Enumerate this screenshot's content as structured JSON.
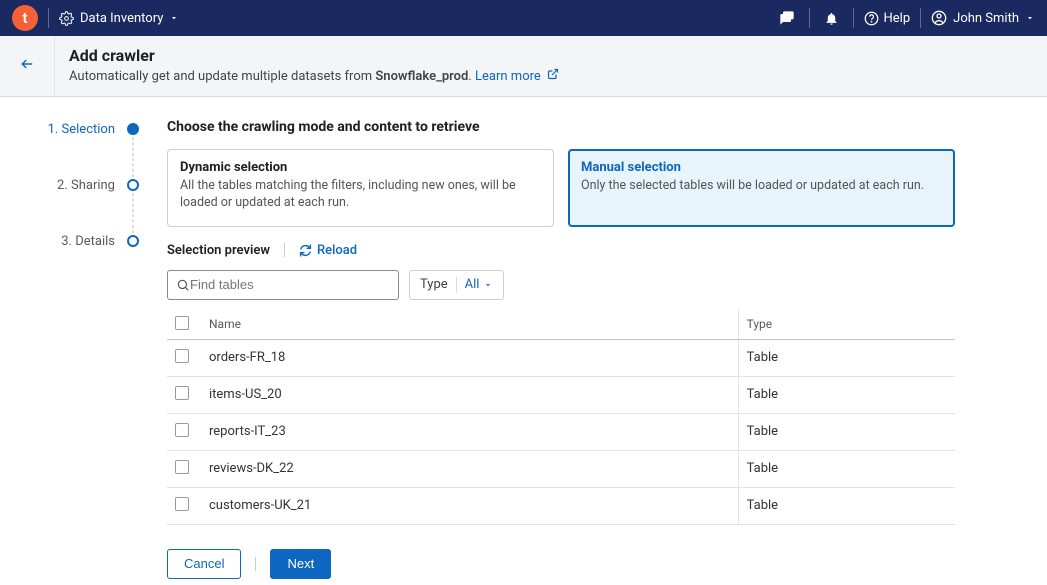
{
  "nav": {
    "app_label": "Data Inventory",
    "help_label": "Help",
    "user_name": "John Smith"
  },
  "header": {
    "title": "Add crawler",
    "sub_pre": "Automatically get and update multiple datasets from ",
    "sub_strong": "Snowflake_prod",
    "sub_post": ". ",
    "learn_more": "Learn more"
  },
  "steps": [
    {
      "label": "1. Selection",
      "active": true,
      "filled": true
    },
    {
      "label": "2. Sharing",
      "active": false,
      "filled": false
    },
    {
      "label": "3. Details",
      "active": false,
      "filled": false
    }
  ],
  "section_heading": "Choose the crawling mode and content to retrieve",
  "modes": {
    "dynamic": {
      "title": "Dynamic selection",
      "desc": "All the tables matching the filters, including new ones, will be loaded or updated at each run."
    },
    "manual": {
      "title": "Manual selection",
      "desc": "Only the selected tables will be loaded or updated at each run."
    }
  },
  "preview": {
    "label": "Selection preview",
    "reload": "Reload"
  },
  "filters": {
    "search_placeholder": "Find tables",
    "type_label": "Type",
    "type_value": "All"
  },
  "table": {
    "col_name": "Name",
    "col_type": "Type",
    "rows": [
      {
        "name": "orders-FR_18",
        "type": "Table"
      },
      {
        "name": "items-US_20",
        "type": "Table"
      },
      {
        "name": "reports-IT_23",
        "type": "Table"
      },
      {
        "name": "reviews-DK_22",
        "type": "Table"
      },
      {
        "name": "customers-UK_21",
        "type": "Table"
      }
    ]
  },
  "footer": {
    "cancel": "Cancel",
    "next": "Next"
  }
}
